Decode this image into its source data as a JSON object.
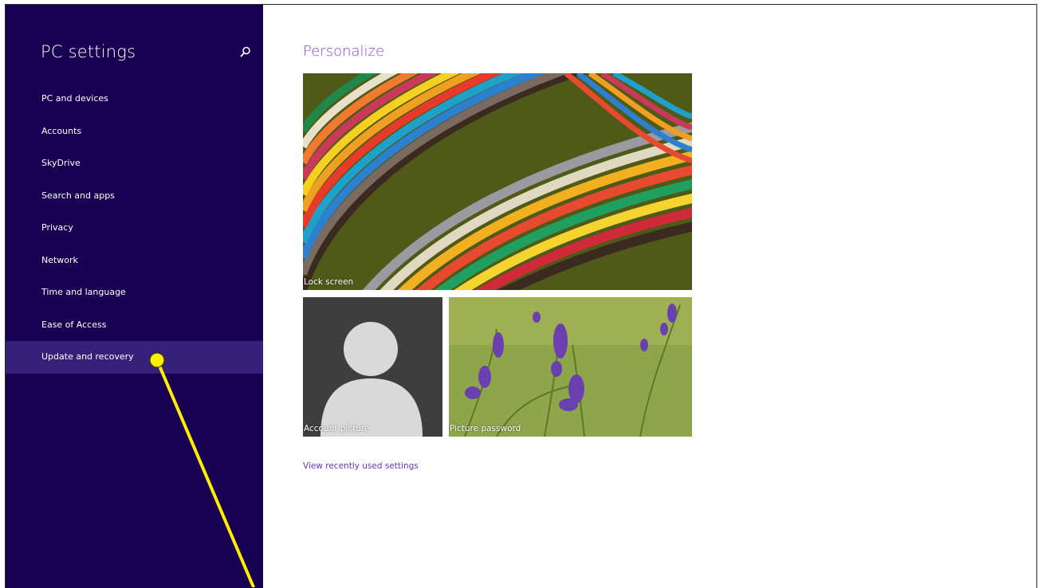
{
  "sidebar": {
    "title": "PC settings",
    "search_icon": "search-icon",
    "items": [
      {
        "label": "PC and devices"
      },
      {
        "label": "Accounts"
      },
      {
        "label": "SkyDrive"
      },
      {
        "label": "Search and apps"
      },
      {
        "label": "Privacy"
      },
      {
        "label": "Network"
      },
      {
        "label": "Time and language"
      },
      {
        "label": "Ease of Access"
      },
      {
        "label": "Update and recovery",
        "selected": true
      }
    ]
  },
  "main": {
    "heading": "Personalize",
    "tiles": {
      "lock_screen": "Lock screen",
      "account_picture": "Account picture",
      "picture_password": "Picture password"
    },
    "recent_link": "View recently used settings"
  },
  "colors": {
    "sidebar_bg": "#180052",
    "selected_bg": "#35217a",
    "accent": "#7a48d8",
    "link": "#6534c8",
    "annotation": "#ffee00"
  }
}
